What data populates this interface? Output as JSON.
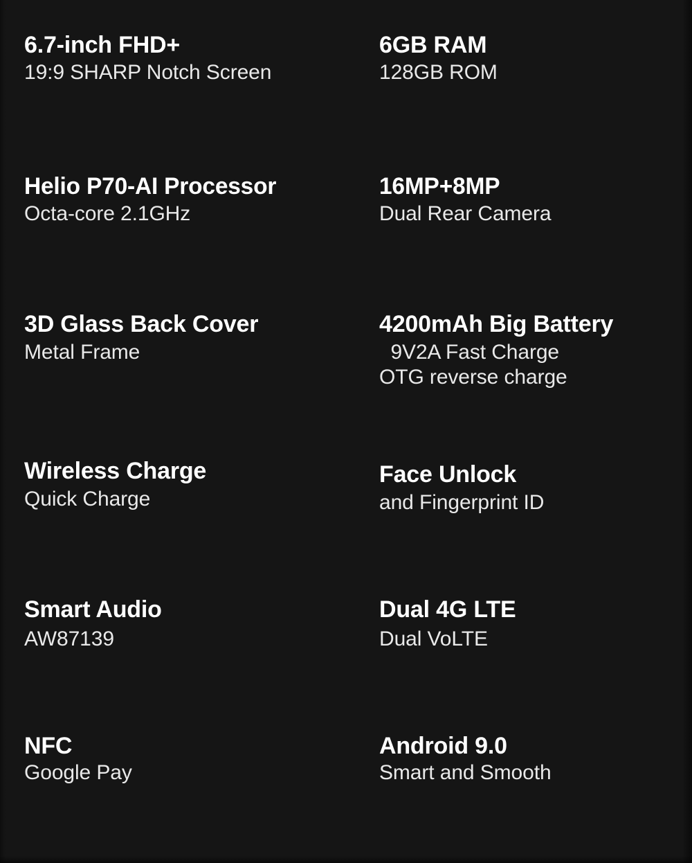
{
  "page": {
    "background_color": "#151515",
    "title_color": "#ffffff",
    "subtitle_color": "#e9e9e9"
  },
  "specs": [
    {
      "left": {
        "title": "6.7-inch FHD+",
        "sub": "19:9 SHARP Notch Screen"
      },
      "right": {
        "title": "6GB RAM",
        "sub": "128GB ROM"
      }
    },
    {
      "left": {
        "title": "Helio P70-AI Processor",
        "sub": "Octa-core 2.1GHz"
      },
      "right": {
        "title": "16MP+8MP",
        "sub": "Dual Rear Camera"
      }
    },
    {
      "left": {
        "title": "3D Glass Back Cover",
        "sub": "Metal Frame"
      },
      "right": {
        "title": "4200mAh Big Battery",
        "sub": "  9V2A Fast Charge\nOTG reverse charge"
      }
    },
    {
      "left": {
        "title": "Wireless Charge",
        "sub": "Quick Charge"
      },
      "right": {
        "title": "Face Unlock",
        "sub": "and Fingerprint ID"
      }
    },
    {
      "left": {
        "title": "Smart Audio",
        "sub": "AW87139"
      },
      "right": {
        "title": "Dual 4G LTE",
        "sub": "Dual VoLTE"
      }
    },
    {
      "left": {
        "title": "NFC",
        "sub": "Google Pay"
      },
      "right": {
        "title": "Android 9.0",
        "sub": "Smart and Smooth"
      }
    }
  ]
}
